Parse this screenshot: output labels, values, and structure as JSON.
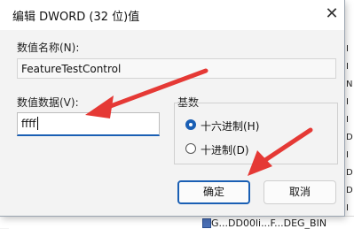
{
  "dialog": {
    "title": "编辑 DWORD (32 位)值",
    "close_symbol": "✕",
    "value_name_label": "数值名称(N):",
    "value_name": "FeatureTestControl",
    "value_data_label": "数值数据(V):",
    "value_data": "ffff",
    "base_group_label": "基数",
    "base_options": [
      {
        "label": "十六进制(H)",
        "selected": true
      },
      {
        "label": "十进制(D)",
        "selected": false
      }
    ],
    "ok_label": "确定",
    "cancel_label": "取消"
  },
  "background": {
    "bottom_row_text": "G...DD00li...F...DEG_BIN",
    "right_column_chars": [
      "I",
      "I",
      "N",
      "I",
      "I",
      "D",
      "I",
      "D",
      "D",
      "I"
    ]
  },
  "annotations": {
    "arrow_color": "#e53935"
  }
}
